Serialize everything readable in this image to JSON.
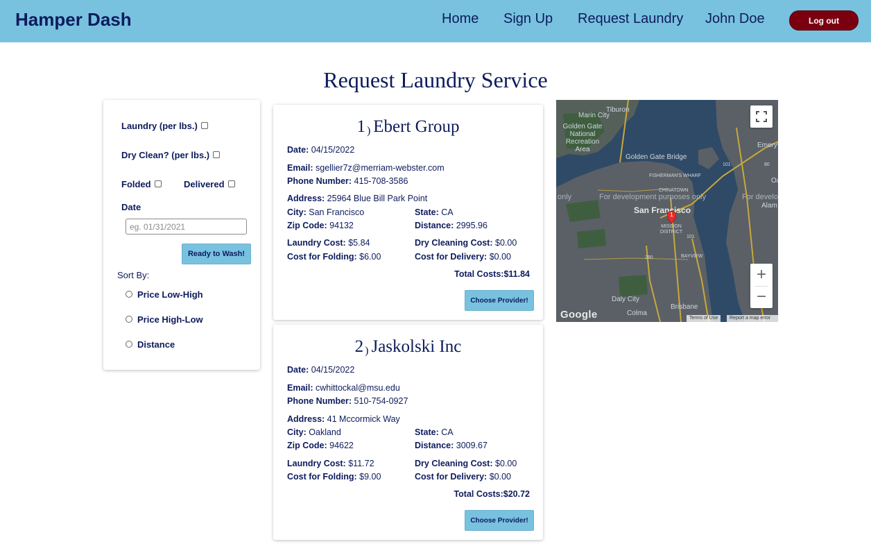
{
  "nav": {
    "brand": "Hamper Dash",
    "links": [
      "Home",
      "Sign Up",
      "Request Laundry",
      "John Doe"
    ],
    "logout": "Log out"
  },
  "page": {
    "title": "Request Laundry Service"
  },
  "filters": {
    "laundry": "Laundry (per lbs.)",
    "dry_clean": "Dry Clean? (per lbs.)",
    "folded": "Folded",
    "delivered": "Delivered",
    "date_label": "Date",
    "date_placeholder": "eg. 01/31/2021",
    "submit": "Ready to Wash!",
    "sort_by": "Sort By:",
    "sort_options": [
      "Price Low-High",
      "Price High-Low",
      "Distance"
    ]
  },
  "labels": {
    "date": "Date:",
    "email": "Email:",
    "phone": "Phone Number:",
    "address": "Address:",
    "city": "City:",
    "state": "State:",
    "zip": "Zip Code:",
    "distance": "Distance:",
    "laundry_cost": "Laundry Cost:",
    "dry_cost": "Dry Cleaning Cost:",
    "folding_cost": "Cost for Folding:",
    "delivery_cost": "Cost for Delivery:",
    "total": "Total Costs:",
    "choose": "Choose Provider!"
  },
  "providers": [
    {
      "num": "1",
      "paren": ")",
      "name": "Ebert Group",
      "date": "04/15/2022",
      "email": "sgellier7z@merriam-webster.com",
      "phone": "415-708-3586",
      "address": "25964 Blue Bill Park Point",
      "city": "San Francisco",
      "state": "CA",
      "zip": "94132",
      "distance": "2995.96",
      "laundry_cost": "$5.84",
      "dry_cost": "$0.00",
      "folding_cost": "$6.00",
      "delivery_cost": "$0.00",
      "total": "$11.84"
    },
    {
      "num": "2",
      "paren": ")",
      "name": "Jaskolski Inc",
      "date": "04/15/2022",
      "email": "cwhittockal@msu.edu",
      "phone": "510-754-0927",
      "address": "41 Mccormick Way",
      "city": "Oakland",
      "state": "CA",
      "zip": "94622",
      "distance": "3009.67",
      "laundry_cost": "$11.72",
      "dry_cost": "$0.00",
      "folding_cost": "$9.00",
      "delivery_cost": "$0.00",
      "total": "$20.72"
    }
  ],
  "map": {
    "places": [
      "Tiburon",
      "Marin City",
      "Golden Gate National Recreation Area",
      "Emeryv",
      "Golden Gate Bridge",
      "FISHERMAN'S WHARF",
      "CHINATOWN",
      "San Francisco",
      "MISSION DISTRICT",
      "BAYVIEW",
      "Daly City",
      "Brisbane",
      "Colma",
      "Alam",
      "Oa"
    ],
    "dev_text_1": "For development purposes only",
    "dev_text_2": "For develo",
    "dev_text_3": "only",
    "highways": [
      "101",
      "80",
      "101",
      "280"
    ],
    "logo": "Google",
    "terms": "Terms of Use",
    "report": "Report a map error",
    "zoom_in": "+",
    "zoom_out": "−",
    "marker": "1",
    "colors": {
      "water": "#2f4a66",
      "land": "#5a6066",
      "park": "#3f5e3f",
      "road": "#c9a83a"
    }
  }
}
